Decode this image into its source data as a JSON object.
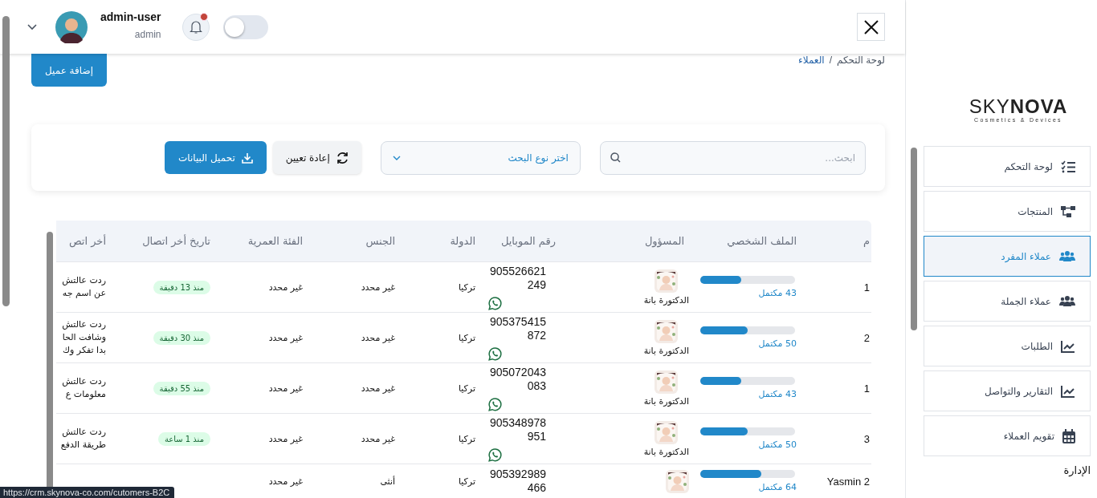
{
  "header": {
    "user_name": "admin-user",
    "user_role": "admin",
    "notifications_unread": true,
    "theme_dark": false
  },
  "breadcrumb": [
    {
      "label": "لوحة التحكم",
      "current": false
    },
    {
      "label": "العملاء",
      "current": true
    }
  ],
  "breadcrumb_separator": "/",
  "add_button": "إضافة عميل",
  "filters": {
    "search_placeholder": "ابحث...",
    "search_type_placeholder": "اختر نوع البحث",
    "reset_button": "إعادة تعيين",
    "download_button": "تحميل البيانات"
  },
  "table": {
    "columns": [
      "م",
      "الملف الشخصي",
      "المسؤول",
      "رقم الموبايل",
      "الدولة",
      "الجنس",
      "الفئة العمرية",
      "تاريخ أخر اتصال",
      "أخر اتص"
    ],
    "rows": [
      {
        "index": "1",
        "level": 0.43,
        "profile_label": "43 مكتمل",
        "owner": "الدكتورة بانة",
        "mobile": "905526621249",
        "whatsapp": true,
        "country": "تركيا",
        "gender": "غير محدد",
        "age_group": "غير محدد",
        "last_contact": "منذ 13 دقيقة",
        "note_lines": [
          "ردت عالتش",
          "عن اسم جه"
        ]
      },
      {
        "index": "2",
        "level": 0.5,
        "profile_label": "50 مكتمل",
        "owner": "الدكتورة بانة",
        "mobile": "905375415872",
        "whatsapp": true,
        "country": "تركيا",
        "gender": "غير محدد",
        "age_group": "غير محدد",
        "last_contact": "منذ 30 دقيقة",
        "note_lines": [
          "ردت عالتش",
          "وشافت الحا",
          "بدا تفكر وك"
        ]
      },
      {
        "index": "1",
        "level": 0.43,
        "profile_label": "43 مكتمل",
        "owner": "الدكتورة بانة",
        "mobile": "905072043083",
        "whatsapp": true,
        "country": "تركيا",
        "gender": "غير محدد",
        "age_group": "غير محدد",
        "last_contact": "منذ 55 دقيقة",
        "note_lines": [
          "ردت عالتش",
          "معلومات ع"
        ]
      },
      {
        "index": "3",
        "level": 0.5,
        "profile_label": "50 مكتمل",
        "owner": "الدكتورة بانة",
        "mobile": "905348978951",
        "whatsapp": true,
        "country": "تركيا",
        "gender": "غير محدد",
        "age_group": "غير محدد",
        "last_contact": "منذ 1 ساعة",
        "note_lines": [
          "ردت عالتش",
          "طريقة الدفع"
        ]
      },
      {
        "index": "Yasmin 2",
        "level": 0.64,
        "profile_label": "64 مكتمل",
        "mobile": "905392989466",
        "country": "تركيا",
        "gender": "أنثى",
        "age_group": "غير محدد"
      }
    ]
  },
  "sidebar": {
    "logo_light": "SKY",
    "logo_bold": "NOVA",
    "logo_tagline": "Cosmetics & Devices",
    "items": [
      {
        "label": "لوحة التحكم",
        "kind": "list",
        "selected": false
      },
      {
        "label": "المنتجات",
        "kind": "sitemap",
        "selected": false
      },
      {
        "label": "عملاء المفرد",
        "kind": "users",
        "selected": true
      },
      {
        "label": "عملاء الجملة",
        "kind": "users",
        "selected": false
      },
      {
        "label": "الطلبات",
        "kind": "chart",
        "selected": false
      },
      {
        "label": "التقارير والتواصل",
        "kind": "chart",
        "selected": false
      },
      {
        "label": "تقويم العملاء",
        "kind": "calendar",
        "selected": false
      }
    ],
    "section_title": "الإدارة"
  },
  "status_url": "https://crm.skynova-co.com/cutomers-B2C"
}
